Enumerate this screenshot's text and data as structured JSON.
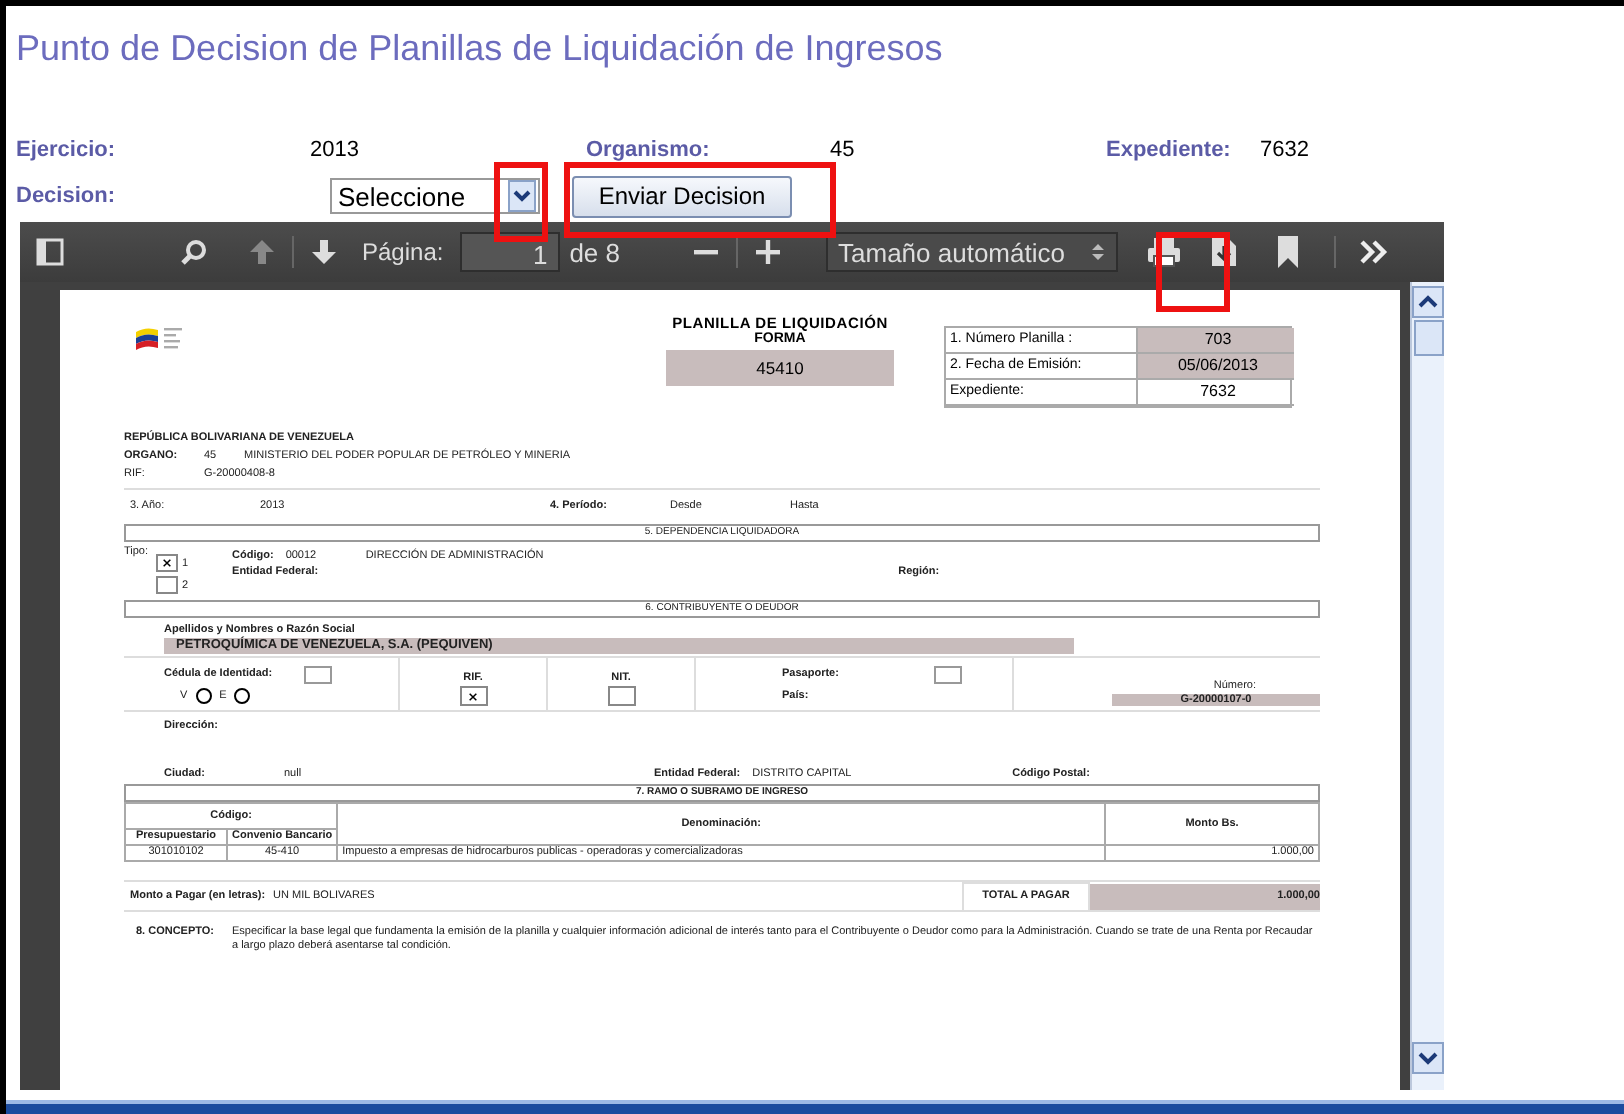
{
  "page_title": "Punto de Decision de Planillas de Liquidación de Ingresos",
  "fields": [
    {
      "label": "Ejercicio:",
      "value": "2013"
    },
    {
      "label": "Organismo:",
      "value": "45"
    },
    {
      "label": "Expediente:",
      "value": "7632"
    }
  ],
  "decision": {
    "label": "Decision:",
    "select_value": "Seleccione",
    "button": "Enviar Decision"
  },
  "viewer": {
    "page_label": "Página:",
    "page_value": "1",
    "page_count": "de 8",
    "zoom": "Tamaño automático"
  },
  "document": {
    "title": "PLANILLA DE LIQUIDACIÓN",
    "subtitle": "FORMA",
    "form_number": "45410",
    "info": [
      {
        "label": "1. Número Planilla :",
        "value": "703",
        "shaded": true
      },
      {
        "label": "2. Fecha de Emisión:",
        "value": "05/06/2013",
        "shaded": true
      },
      {
        "label": "Expediente:",
        "value": "7632",
        "shaded": false
      }
    ],
    "republic": "REPÚBLICA BOLIVARIANA DE VENEZUELA",
    "organo": {
      "label": "ORGANO:",
      "code": "45",
      "name": "MINISTERIO DEL PODER POPULAR DE PETRÓLEO Y MINERIA"
    },
    "rif": {
      "label": "RIF:",
      "value": "G-20000408-8"
    },
    "year": {
      "label": "3. Año:",
      "value": "2013"
    },
    "period": {
      "label": "4. Período:",
      "from": "Desde",
      "to": "Hasta"
    },
    "section_5": {
      "title": "5. DEPENDENCIA LIQUIDADORA",
      "tipo_label": "Tipo:",
      "tipo_options": [
        {
          "label": "1",
          "checked": true
        },
        {
          "label": "2",
          "checked": false
        }
      ],
      "codigo_label": "Código:",
      "codigo": "00012",
      "dependencia": "DIRECCIÓN DE ADMINISTRACIÓN",
      "entidad_label": "Entidad Federal:",
      "region_label": "Región:"
    },
    "section_6": {
      "title": "6. CONTRIBUYENTE O DEUDOR",
      "name_label": "Apellidos y Nombres o Razón Social",
      "name": "PETROQUÍMICA DE VENEZUELA, S.A. (PEQUIVEN)",
      "cedula_label": "Cédula de Identidad:",
      "cedula_options": [
        {
          "label": "V",
          "selected": false
        },
        {
          "label": "E",
          "selected": false
        }
      ],
      "id_types": [
        {
          "label": "RIF.",
          "checked": true
        },
        {
          "label": "NIT.",
          "checked": false
        }
      ],
      "pasaporte_label": "Pasaporte:",
      "pais_label": "País:",
      "numero_label": "Número:",
      "numero": "G-20000107-0",
      "direccion_label": "Dirección:",
      "ciudad_label": "Ciudad:",
      "ciudad": "null",
      "entidad_label": "Entidad Federal:",
      "entidad": "DISTRITO CAPITAL",
      "postal_label": "Código Postal:"
    },
    "section_7": {
      "title": "7. RAMO O SUBRAMO DE INGRESO",
      "codigo_header": "Código:",
      "columns": [
        "Presupuestario",
        "Convenio Bancario",
        "Denominación:",
        "Monto Bs."
      ],
      "rows": [
        [
          "301010102",
          "45-410",
          "Impuesto a empresas de hidrocarburos publicas - operadoras y comercializadoras",
          "1.000,00"
        ]
      ]
    },
    "amount_words_label": "Monto a Pagar (en letras):",
    "amount_words": "UN MIL BOLIVARES",
    "total_label": "TOTAL A PAGAR",
    "total": "1.000,00",
    "concept_label": "8. CONCEPTO:",
    "concept": "Especificar la base legal que fundamenta la emisión de la planilla y cualquier información adicional de interés tanto para el Contribuyente o Deudor como para la Administración. Cuando se trate de una Renta por Recaudar a largo plazo deberá asentarse tal condición."
  }
}
